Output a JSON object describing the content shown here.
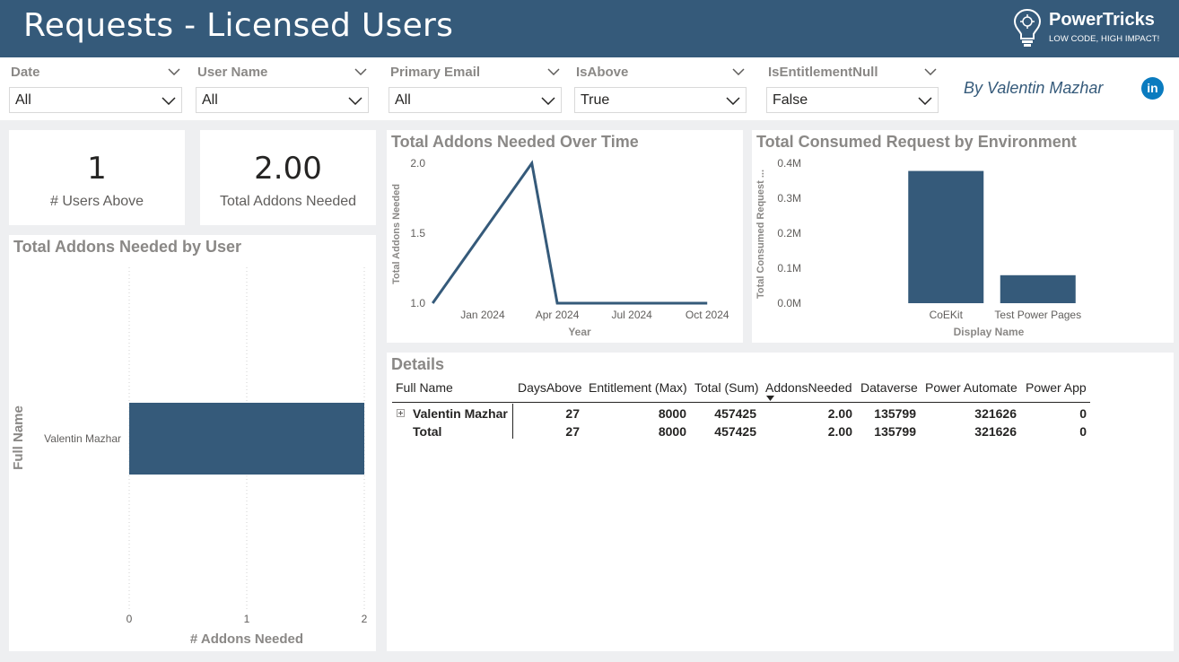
{
  "header": {
    "title": "Requests - Licensed Users",
    "brand_name": "PowerTricks",
    "brand_tagline": "LOW CODE, HIGH IMPACT!"
  },
  "filters": [
    {
      "label": "Date",
      "value": "All"
    },
    {
      "label": "User Name",
      "value": "All"
    },
    {
      "label": "Primary Email",
      "value": "All"
    },
    {
      "label": "IsAbove",
      "value": "True"
    },
    {
      "label": "IsEntitlementNull",
      "value": "False"
    }
  ],
  "byline": "By Valentin Mazhar",
  "linkedin_icon": "in",
  "kpis": {
    "users_above": {
      "value": "1",
      "label": "# Users Above"
    },
    "addons_needed": {
      "value": "2.00",
      "label": "Total Addons Needed"
    }
  },
  "colors": {
    "bar": "#355a7a",
    "line": "#355a7a",
    "header": "#355a7a"
  },
  "chart_data": [
    {
      "id": "addons_by_user",
      "type": "bar",
      "orientation": "horizontal",
      "title": "Total Addons Needed by User",
      "xlabel": "# Addons Needed",
      "ylabel": "Full Name",
      "categories": [
        "Valentin Mazhar"
      ],
      "values": [
        2
      ],
      "xlim": [
        0,
        2
      ],
      "xticks": [
        "0",
        "1",
        "2"
      ],
      "grid": true
    },
    {
      "id": "addons_over_time",
      "type": "line",
      "title": "Total Addons Needed Over Time",
      "xlabel": "Year",
      "ylabel": "Total Addons Needed",
      "x": [
        "2023-11",
        "2024-03",
        "2024-04",
        "2024-06",
        "2024-08",
        "2024-10"
      ],
      "values": [
        1.0,
        2.0,
        1.0,
        1.0,
        1.0,
        1.0
      ],
      "ylim": [
        1.0,
        2.0
      ],
      "yticks": [
        "1.0",
        "1.5",
        "2.0"
      ],
      "xticks": [
        "Jan 2024",
        "Apr 2024",
        "Jul 2024",
        "Oct 2024"
      ],
      "grid": false
    },
    {
      "id": "consumed_by_env",
      "type": "bar",
      "orientation": "vertical",
      "title": "Total Consumed Request by Environment",
      "xlabel": "Display Name",
      "ylabel": "Total Consumed Request ...",
      "categories": [
        "CoEKit",
        "Test Power Pages"
      ],
      "values": [
        378000,
        80000
      ],
      "ylim": [
        0,
        400000
      ],
      "yticks": [
        "0.0M",
        "0.1M",
        "0.2M",
        "0.3M",
        "0.4M"
      ],
      "grid": false
    }
  ],
  "details": {
    "title": "Details",
    "columns": [
      "Full Name",
      "DaysAbove",
      "Entitlement (Max)",
      "Total (Sum)",
      "AddonsNeeded",
      "Dataverse",
      "Power Automate",
      "Power App"
    ],
    "rows": [
      [
        "Valentin Mazhar",
        "27",
        "8000",
        "457425",
        "2.00",
        "135799",
        "321626",
        "0"
      ]
    ],
    "total": [
      "Total",
      "27",
      "8000",
      "457425",
      "2.00",
      "135799",
      "321626",
      "0"
    ],
    "sorted_column": "AddonsNeeded"
  }
}
